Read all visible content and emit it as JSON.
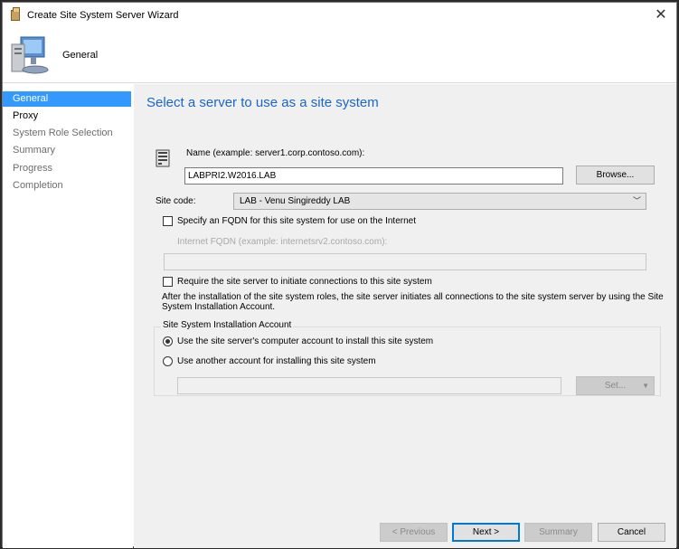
{
  "window": {
    "title": "Create Site System Server Wizard",
    "close_glyph": "✕"
  },
  "header": {
    "title": "General",
    "icon": "computer-icon"
  },
  "sidebar": {
    "items": [
      {
        "label": "General",
        "state": "active"
      },
      {
        "label": "Proxy",
        "state": "enabled"
      },
      {
        "label": "System Role Selection",
        "state": "disabled"
      },
      {
        "label": "Summary",
        "state": "disabled"
      },
      {
        "label": "Progress",
        "state": "disabled"
      },
      {
        "label": "Completion",
        "state": "disabled"
      }
    ]
  },
  "main": {
    "page_title": "Select a server to use as a site system",
    "name_label": "Name (example: server1.corp.contoso.com):",
    "name_value": "LABPRI2.W2016.LAB",
    "browse_label": "Browse...",
    "site_code_label": "Site code:",
    "site_code_value": "LAB - Venu Singireddy LAB",
    "fqdn_checkbox_label": "Specify an FQDN for this site system for use on the Internet",
    "internet_fqdn_label": "Internet FQDN (example: internetsrv2.contoso.com):",
    "internet_fqdn_value": "",
    "require_checkbox_label": "Require the site server to initiate connections to this site system",
    "info_text": "After the  installation of the site system roles, the site server initiates all connections to the site system server by using the Site System Installation Account.",
    "group_label": "Site System Installation Account",
    "radio_computer_label": "Use the site server's computer account to install this site system",
    "radio_other_label": "Use another account for installing this site system",
    "account_value": "",
    "set_label": "Set..."
  },
  "footer": {
    "previous_label": "< Previous",
    "next_label": "Next >",
    "summary_label": "Summary",
    "cancel_label": "Cancel"
  },
  "colors": {
    "accent": "#3399ff",
    "title_blue": "#1a66c7",
    "panel_bg": "#f0f0f0"
  }
}
